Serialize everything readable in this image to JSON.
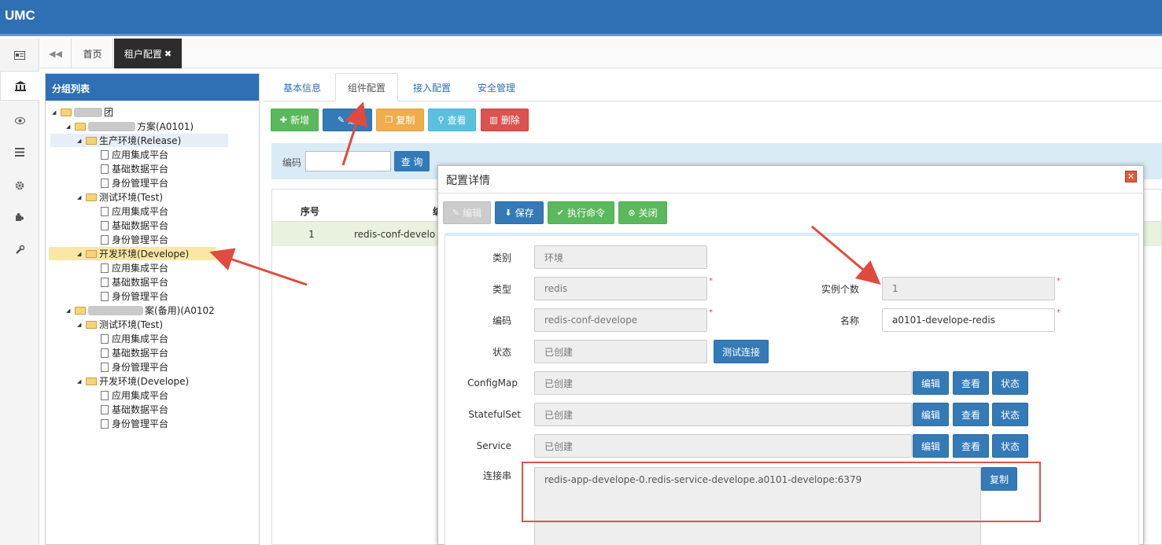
{
  "app": {
    "logo": "UMC"
  },
  "rail": {
    "icons": [
      "id-card-icon",
      "bank-icon",
      "eye-icon",
      "list-icon",
      "gear-icon",
      "puzzle-icon",
      "wrench-icon"
    ]
  },
  "tabs": {
    "back": "◀◀",
    "home": "首页",
    "active": "租户配置",
    "close": "✖"
  },
  "group_panel": {
    "title": "分组列表",
    "tree": {
      "root": "团",
      "plan1": "方案(A0101)",
      "env_release": "生产环境(Release)",
      "env_test": "测试环境(Test)",
      "env_develope": "开发环境(Develope)",
      "plan2": "案(备用)(A0102",
      "leaf_app": "应用集成平台",
      "leaf_data": "基础数据平台",
      "leaf_identity": "身份管理平台"
    }
  },
  "content_tabs": [
    "基本信息",
    "组件配置",
    "接入配置",
    "安全管理"
  ],
  "toolbar": {
    "add": "新增",
    "edit": "编",
    "copy": "复制",
    "view": "查看",
    "delete": "删除"
  },
  "search": {
    "label": "编码",
    "button": "查 询"
  },
  "table": {
    "headers": [
      "序号",
      "编"
    ],
    "rows": [
      {
        "index": "1",
        "code": "redis-conf-develo"
      }
    ]
  },
  "dialog": {
    "title": "配置详情",
    "close": "✕",
    "buttons": {
      "edit": "编辑",
      "save": "保存",
      "exec": "执行命令",
      "close": "关闭"
    },
    "fields": {
      "category_label": "类别",
      "category_value": "环境",
      "type_label": "类型",
      "type_value": "redis",
      "instances_label": "实例个数",
      "instances_value": "1",
      "code_label": "编码",
      "code_value": "redis-conf-develope",
      "name_label": "名称",
      "name_value": "a0101-develope-redis",
      "status_label": "状态",
      "status_value": "已创建",
      "test_conn": "测试连接",
      "configmap_label": "ConfigMap",
      "configmap_value": "已创建",
      "statefulset_label": "StatefulSet",
      "statefulset_value": "已创建",
      "service_label": "Service",
      "service_value": "已创建",
      "row_edit": "编辑",
      "row_view": "查看",
      "row_status": "状态",
      "conn_label": "连接串",
      "conn_value": "redis-app-develope-0.redis-service-develope.a0101-develope:6379",
      "conn_copy": "复制",
      "required": "*"
    }
  },
  "colors": {
    "header": "#2f6fb3",
    "accent_red": "#d9534f",
    "highlight": "#fbe7a4"
  }
}
